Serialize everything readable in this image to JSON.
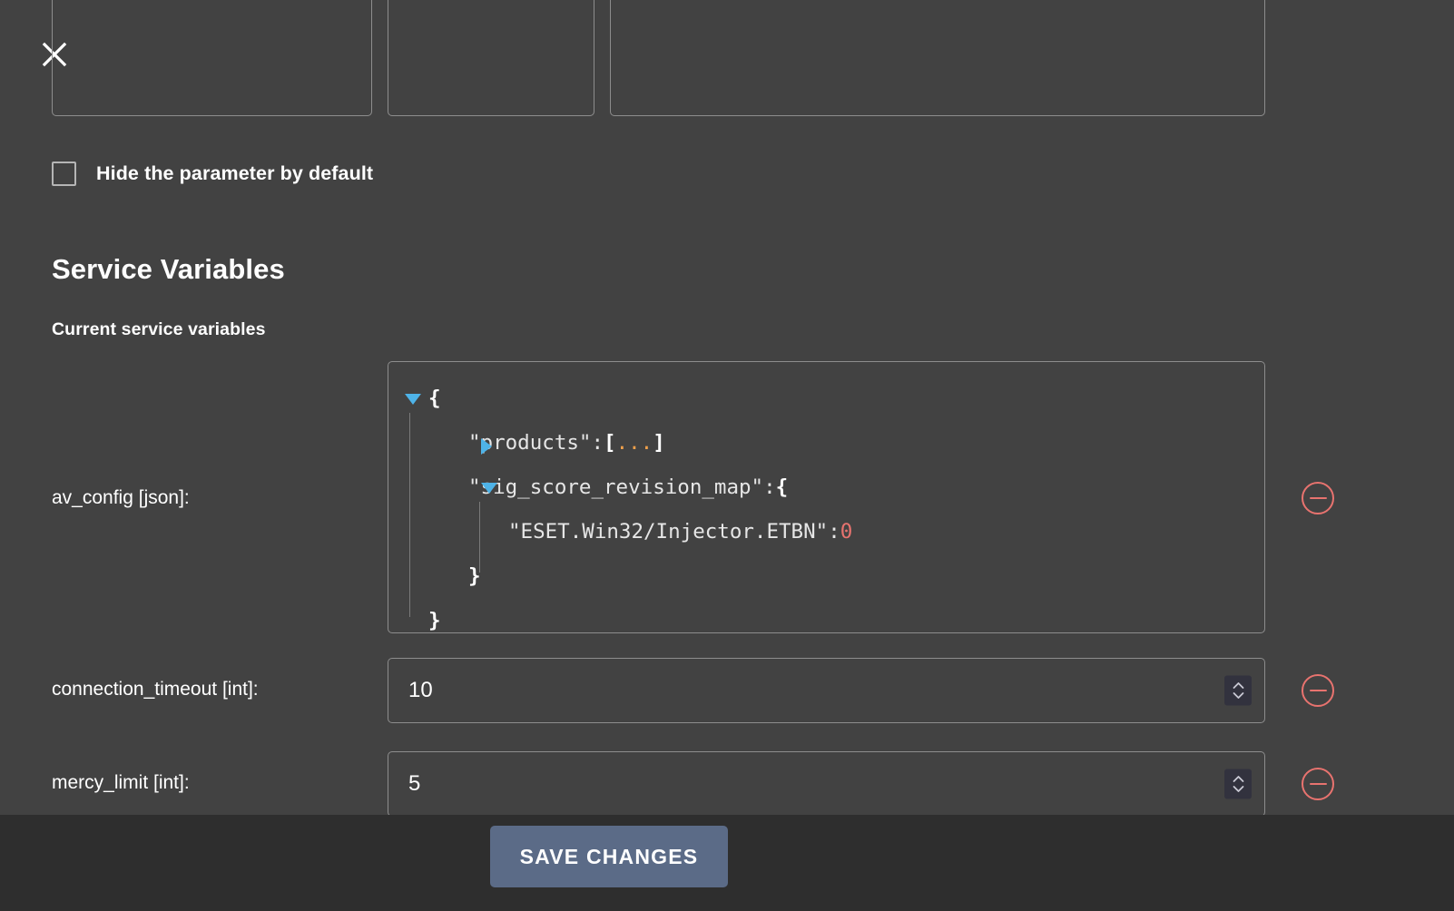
{
  "dialog": {
    "close_icon": "close-icon"
  },
  "parameter_section": {
    "hide_checkbox_label": "Hide the parameter by default",
    "hide_checkbox_checked": false
  },
  "service_variables": {
    "title": "Service Variables",
    "subtitle": "Current service variables",
    "rows": [
      {
        "label": "av_config [json]:",
        "type": "json",
        "remove_icon": "minus-circle-icon",
        "json_lines": [
          {
            "indent": 0,
            "twisty": "open",
            "text": "{"
          },
          {
            "indent": 1,
            "twisty": "closed",
            "key": "\"products\"",
            "sep": " : ",
            "open": "[",
            "dots": "...",
            "close": "]"
          },
          {
            "indent": 1,
            "twisty": "open",
            "key": "\"sig_score_revision_map\"",
            "sep": " : ",
            "open": "{"
          },
          {
            "indent": 2,
            "twisty": "none",
            "key": "\"ESET.Win32/Injector.ETBN\"",
            "sep": " : ",
            "value": "0",
            "value_type": "number"
          },
          {
            "indent": 1,
            "twisty": "none",
            "text": "}"
          },
          {
            "indent": 0,
            "twisty": "none",
            "text": "}"
          }
        ]
      },
      {
        "label": "connection_timeout [int]:",
        "type": "int",
        "value": "10",
        "remove_icon": "minus-circle-icon",
        "stepper_icon": "stepper-up-down-icon"
      },
      {
        "label": "mercy_limit [int]:",
        "type": "int",
        "value": "5",
        "remove_icon": "minus-circle-icon",
        "stepper_icon": "stepper-up-down-icon"
      }
    ]
  },
  "footer": {
    "save_label": "SAVE CHANGES"
  },
  "colors": {
    "background": "#424242",
    "footer_background": "#2e2e2e",
    "save_button": "#5b6b87",
    "remove_accent": "#e8736f",
    "json_twisty": "#4eb3e8",
    "json_dots": "#f0a04b",
    "json_number": "#e8736f",
    "field_border": "#8d8d8d"
  }
}
